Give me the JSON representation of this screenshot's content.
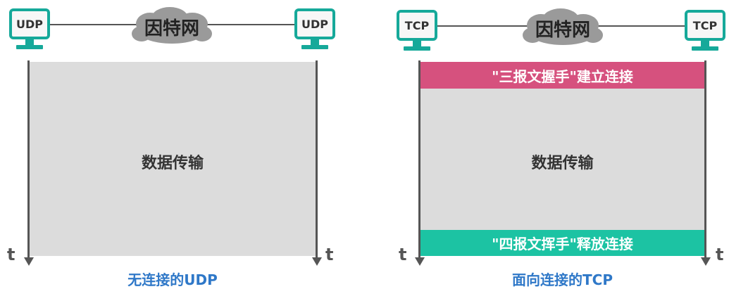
{
  "udp_panel": {
    "left_host": "UDP",
    "right_host": "UDP",
    "network": "因特网",
    "body": "数据传输",
    "time_left": "t",
    "time_right": "t",
    "caption": "无连接的UDP"
  },
  "tcp_panel": {
    "left_host": "TCP",
    "right_host": "TCP",
    "network": "因特网",
    "setup": "\"三报文握手\"建立连接",
    "body": "数据传输",
    "teardown": "\"四报文挥手\"释放连接",
    "time_left": "t",
    "time_right": "t",
    "caption": "面向连接的TCP"
  },
  "colors": {
    "host": "#16a99a",
    "setup_band": "#d6517e",
    "teardown_band": "#1cc3a3",
    "area": "#dcdcdc",
    "caption": "#2f78c8",
    "cloud": "#9a9a9a"
  },
  "icons": [
    "computer-icon",
    "cloud-icon",
    "arrow-down-icon"
  ]
}
